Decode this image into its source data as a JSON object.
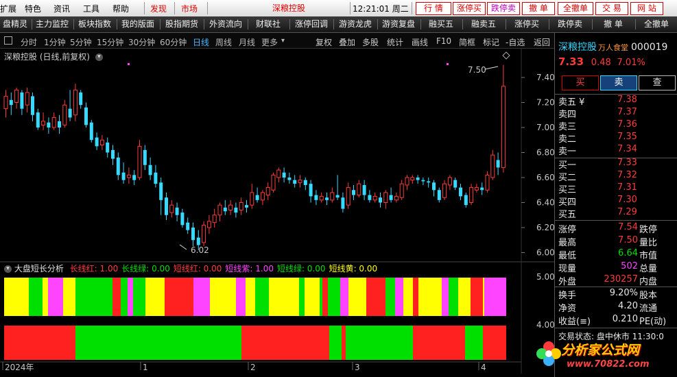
{
  "menu": {
    "items": [
      "扩展",
      "特色",
      "资讯",
      "工具",
      "帮助"
    ],
    "red_items": [
      "发现",
      "市场"
    ],
    "stock_title": "深粮控股",
    "clock": "12:21:01 周二",
    "trade_buttons": [
      "行 情",
      "涨停买",
      "跌停卖",
      "撤 单",
      "全撤单",
      "交 易",
      "网 站"
    ]
  },
  "toolbar": {
    "items": [
      "盘精灵",
      "主力监控",
      "板块指数",
      "我的版面",
      "股指期货",
      "外资流向",
      "财联社",
      "涨停回调",
      "游资龙虎",
      "游资复盘",
      "融买五",
      "融卖五",
      "涨停买",
      "跌停卖",
      "撤 单",
      "全撤单"
    ]
  },
  "periods": {
    "items": [
      "分时",
      "1分钟",
      "5分钟",
      "15分钟",
      "30分钟",
      "60分钟",
      "日线",
      "周线",
      "月线",
      "更多"
    ],
    "active": "日线",
    "functions": [
      "复权",
      "叠加",
      "多股",
      "统计",
      "画线",
      "F10",
      "简框",
      "标记",
      "-自选",
      "返回"
    ]
  },
  "chart": {
    "title": "深粮控股 (日线,前复权)",
    "annotation_high": "7.50",
    "annotation_low": "6.02",
    "y_labels": [
      "7.40",
      "7.20",
      "7.00",
      "6.80",
      "6.60",
      "6.40",
      "6.20",
      "6.00"
    ],
    "indicator_title": "大盘短长分析",
    "indicator_values": [
      {
        "label": "长线红: 1.00",
        "color": "#ff3b3b"
      },
      {
        "label": "长线绿: 0.00",
        "color": "#00e000"
      },
      {
        "label": "短线红: 0.00",
        "color": "#ff3b3b"
      },
      {
        "label": "短线紫: 1.00",
        "color": "#ff44ff"
      },
      {
        "label": "短线绿: 0.00",
        "color": "#00e000"
      },
      {
        "label": "短线黄: 0.00",
        "color": "#ffff00"
      }
    ],
    "indicator_y_labels": [
      "5.00",
      "4.00"
    ],
    "x_labels": [
      "2024年",
      "1",
      "2",
      "3",
      "4"
    ],
    "colors": {
      "up": "#ff3b3b",
      "down": "#37d9ff",
      "bg": "#000000"
    }
  },
  "panel": {
    "name": "深粮控股",
    "tag": "万人食堂",
    "code": "000019",
    "price": "7.33",
    "change": "0.48",
    "change_pct": "7.01%",
    "buttons": [
      "买",
      "卖",
      "查"
    ],
    "sells": [
      {
        "label": "卖五 ¥",
        "price": "7.38"
      },
      {
        "label": "卖四",
        "price": "7.37"
      },
      {
        "label": "卖三",
        "price": "7.36"
      },
      {
        "label": "卖二",
        "price": "7.35"
      },
      {
        "label": "卖一",
        "price": "7.34"
      }
    ],
    "buys": [
      {
        "label": "买一",
        "price": "7.33"
      },
      {
        "label": "买二",
        "price": "7.32"
      },
      {
        "label": "买三",
        "price": "7.31"
      },
      {
        "label": "买四",
        "price": "7.30"
      },
      {
        "label": "买五",
        "price": "7.29"
      }
    ],
    "stats": [
      {
        "k": "涨停",
        "v": "7.54",
        "k2": "跌停"
      },
      {
        "k": "最高",
        "v": "7.50",
        "k2": "量比"
      },
      {
        "k": "最低",
        "v": "6.64",
        "k2": "市值"
      },
      {
        "k": "现量",
        "v": "502",
        "k2": "总量"
      },
      {
        "k": "外盘",
        "v": "230257",
        "k2": "内盘"
      }
    ],
    "stats2": [
      {
        "k": "换手",
        "v": "9.20%",
        "k2": "股本"
      },
      {
        "k": "净资",
        "v": "4.20",
        "k2": "流通"
      },
      {
        "k": "收益(≡)",
        "v": "0.210",
        "k2": "PE(动)"
      }
    ],
    "footer_text": "交易状态: 盘中休市 11:30:0",
    "watermark": "分析家公式网",
    "watermark_url": "www.70822.com"
  }
}
